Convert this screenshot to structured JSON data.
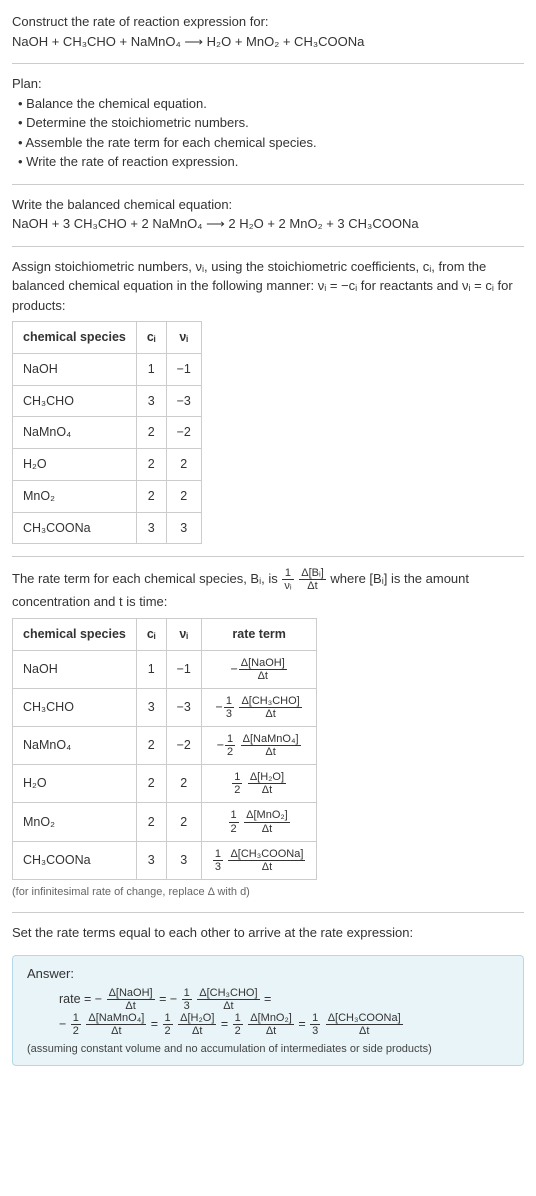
{
  "header": {
    "prompt_line1": "Construct the rate of reaction expression for:",
    "prompt_eq": "NaOH + CH₃CHO + NaMnO₄ ⟶ H₂O + MnO₂ + CH₃COONa"
  },
  "plan": {
    "heading": "Plan:",
    "items": [
      "• Balance the chemical equation.",
      "• Determine the stoichiometric numbers.",
      "• Assemble the rate term for each chemical species.",
      "• Write the rate of reaction expression."
    ]
  },
  "balanced": {
    "heading": "Write the balanced chemical equation:",
    "eq": "NaOH + 3 CH₃CHO + 2 NaMnO₄ ⟶ 2 H₂O + 2 MnO₂ + 3 CH₃COONa"
  },
  "assign": {
    "text": "Assign stoichiometric numbers, νᵢ, using the stoichiometric coefficients, cᵢ, from the balanced chemical equation in the following manner: νᵢ = −cᵢ for reactants and νᵢ = cᵢ for products:",
    "headers": [
      "chemical species",
      "cᵢ",
      "νᵢ"
    ],
    "rows": [
      {
        "species": "NaOH",
        "c": "1",
        "v": "−1"
      },
      {
        "species": "CH₃CHO",
        "c": "3",
        "v": "−3"
      },
      {
        "species": "NaMnO₄",
        "c": "2",
        "v": "−2"
      },
      {
        "species": "H₂O",
        "c": "2",
        "v": "2"
      },
      {
        "species": "MnO₂",
        "c": "2",
        "v": "2"
      },
      {
        "species": "CH₃COONa",
        "c": "3",
        "v": "3"
      }
    ]
  },
  "rate_intro": {
    "part1": "The rate term for each chemical species, Bᵢ, is ",
    "frac1_num": "1",
    "frac1_den": "νᵢ",
    "frac2_num": "Δ[Bᵢ]",
    "frac2_den": "Δt",
    "part2": " where [Bᵢ] is the amount concentration and t is time:"
  },
  "rate_table": {
    "headers": [
      "chemical species",
      "cᵢ",
      "νᵢ",
      "rate term"
    ],
    "rows": [
      {
        "species": "NaOH",
        "c": "1",
        "v": "−1",
        "term_prefix": "−",
        "term_coef_num": "",
        "term_coef_den": "",
        "term_num": "Δ[NaOH]",
        "term_den": "Δt"
      },
      {
        "species": "CH₃CHO",
        "c": "3",
        "v": "−3",
        "term_prefix": "−",
        "term_coef_num": "1",
        "term_coef_den": "3",
        "term_num": "Δ[CH₃CHO]",
        "term_den": "Δt"
      },
      {
        "species": "NaMnO₄",
        "c": "2",
        "v": "−2",
        "term_prefix": "−",
        "term_coef_num": "1",
        "term_coef_den": "2",
        "term_num": "Δ[NaMnO₄]",
        "term_den": "Δt"
      },
      {
        "species": "H₂O",
        "c": "2",
        "v": "2",
        "term_prefix": "",
        "term_coef_num": "1",
        "term_coef_den": "2",
        "term_num": "Δ[H₂O]",
        "term_den": "Δt"
      },
      {
        "species": "MnO₂",
        "c": "2",
        "v": "2",
        "term_prefix": "",
        "term_coef_num": "1",
        "term_coef_den": "2",
        "term_num": "Δ[MnO₂]",
        "term_den": "Δt"
      },
      {
        "species": "CH₃COONa",
        "c": "3",
        "v": "3",
        "term_prefix": "",
        "term_coef_num": "1",
        "term_coef_den": "3",
        "term_num": "Δ[CH₃COONa]",
        "term_den": "Δt"
      }
    ],
    "caption": "(for infinitesimal rate of change, replace Δ with d)"
  },
  "set_equal": "Set the rate terms equal to each other to arrive at the rate expression:",
  "answer": {
    "label": "Answer:",
    "line1_a": "rate = −",
    "f1_num": "Δ[NaOH]",
    "f1_den": "Δt",
    "line1_b": " = −",
    "f2a_num": "1",
    "f2a_den": "3",
    "f2_num": "Δ[CH₃CHO]",
    "f2_den": "Δt",
    "line1_c": " =",
    "line2_a": "−",
    "f3a_num": "1",
    "f3a_den": "2",
    "f3_num": "Δ[NaMnO₄]",
    "f3_den": "Δt",
    "line2_b": " = ",
    "f4a_num": "1",
    "f4a_den": "2",
    "f4_num": "Δ[H₂O]",
    "f4_den": "Δt",
    "line2_c": " = ",
    "f5a_num": "1",
    "f5a_den": "2",
    "f5_num": "Δ[MnO₂]",
    "f5_den": "Δt",
    "line2_d": " = ",
    "f6a_num": "1",
    "f6a_den": "3",
    "f6_num": "Δ[CH₃COONa]",
    "f6_den": "Δt",
    "note": "(assuming constant volume and no accumulation of intermediates or side products)"
  }
}
